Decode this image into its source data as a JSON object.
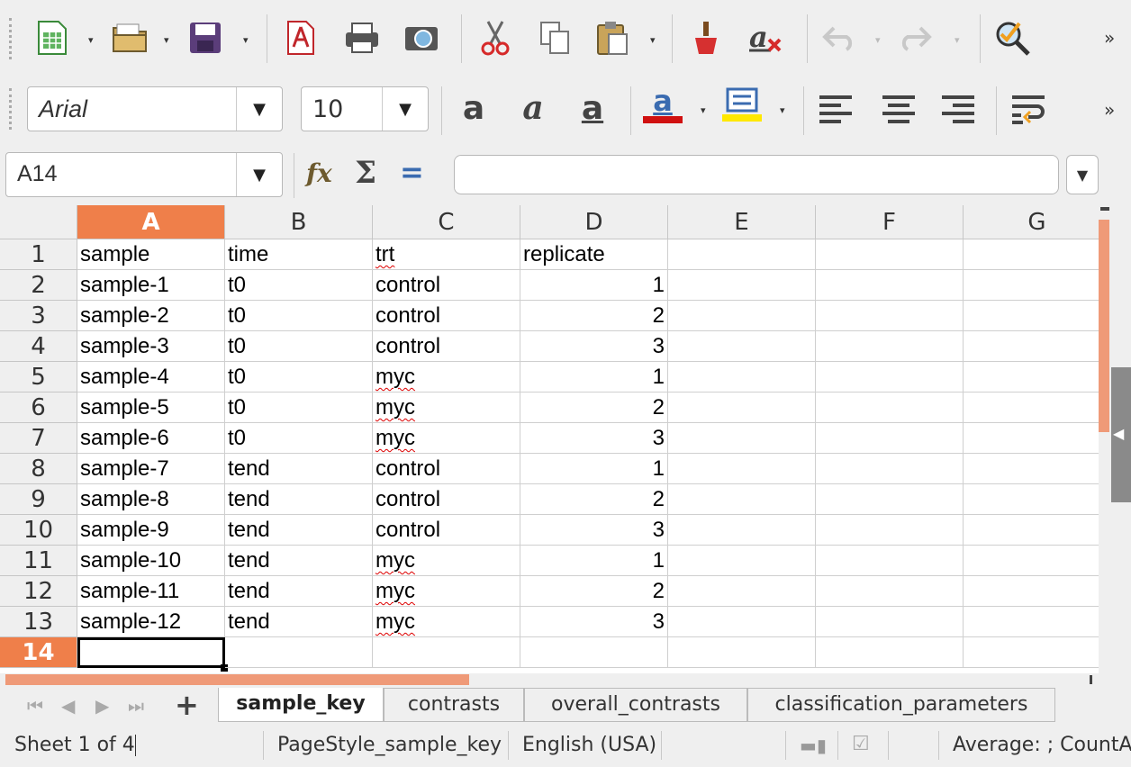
{
  "toolbar1": {
    "icons": [
      "new-spreadsheet-icon",
      "open-folder-icon",
      "save-icon",
      "export-pdf-icon",
      "print-icon",
      "print-preview-icon",
      "cut-icon",
      "copy-icon",
      "paste-icon",
      "clone-formatting-icon",
      "clear-formatting-icon",
      "undo-icon",
      "redo-icon",
      "spelling-icon"
    ],
    "overflow": "»"
  },
  "toolbar2": {
    "font_name": "Arial",
    "font_size": "10",
    "font_color": "#d01010",
    "highlight_color": "#ffe800",
    "overflow": "»"
  },
  "formula_bar": {
    "name_box": "A14",
    "formula_value": ""
  },
  "sheet": {
    "columns": [
      "A",
      "B",
      "C",
      "D",
      "E",
      "F",
      "G"
    ],
    "selected_column": "A",
    "selected_row": "14",
    "row_numbers": [
      "1",
      "2",
      "3",
      "4",
      "5",
      "6",
      "7",
      "8",
      "9",
      "10",
      "11",
      "12",
      "13",
      "14"
    ],
    "rows": [
      [
        "sample",
        "time",
        "trt",
        "replicate"
      ],
      [
        "sample-1",
        "t0",
        "control",
        "1"
      ],
      [
        "sample-2",
        "t0",
        "control",
        "2"
      ],
      [
        "sample-3",
        "t0",
        "control",
        "3"
      ],
      [
        "sample-4",
        "t0",
        "myc",
        "1"
      ],
      [
        "sample-5",
        "t0",
        "myc",
        "2"
      ],
      [
        "sample-6",
        "t0",
        "myc",
        "3"
      ],
      [
        "sample-7",
        "tend",
        "control",
        "1"
      ],
      [
        "sample-8",
        "tend",
        "control",
        "2"
      ],
      [
        "sample-9",
        "tend",
        "control",
        "3"
      ],
      [
        "sample-10",
        "tend",
        "myc",
        "1"
      ],
      [
        "sample-11",
        "tend",
        "myc",
        "2"
      ],
      [
        "sample-12",
        "tend",
        "myc",
        "3"
      ],
      [
        "",
        "",
        "",
        ""
      ]
    ]
  },
  "tabs": {
    "add": "+",
    "items": [
      "sample_key",
      "contrasts",
      "overall_contrasts",
      "classification_parameters"
    ],
    "active": "sample_key"
  },
  "status": {
    "sheet": "Sheet 1 of 4",
    "page_style": "PageStyle_sample_key",
    "language": "English (USA)",
    "summary": "Average: ; CountA"
  },
  "colors": {
    "accent": "#ef7f4a"
  }
}
